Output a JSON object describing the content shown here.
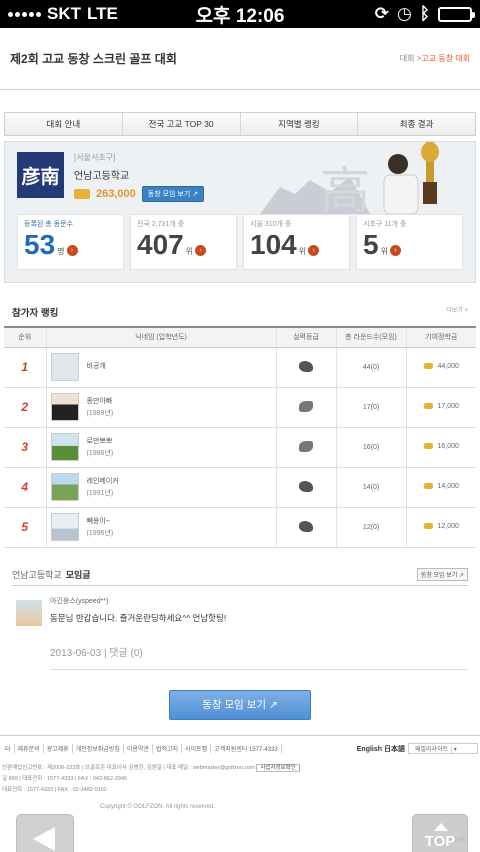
{
  "status_bar": {
    "carrier": "SKT",
    "network": "LTE",
    "time": "오후 12:06"
  },
  "header": {
    "title": "제2회 고교 동창 스크린 골프 대회",
    "crumb_home": "대회 >",
    "crumb_current": "고교 동창 대회"
  },
  "tabs": [
    "대회 안내",
    "전국 고교 TOP 30",
    "지역별 랭킹",
    "최종 결과"
  ],
  "school": {
    "emblem_text": "彦南",
    "region": "[서울서초구]",
    "name": "언남고등학교",
    "points": "263,000",
    "join_label": "동창 모임 보기"
  },
  "stats": [
    {
      "label": "등록된 총 동문수",
      "value": "53",
      "unit": "명"
    },
    {
      "label": "전국 2,731개 중",
      "value": "407",
      "unit": "위"
    },
    {
      "label": "서울 310개 중",
      "value": "104",
      "unit": "위"
    },
    {
      "label": "서초구 11개 중",
      "value": "5",
      "unit": "위"
    }
  ],
  "ranking": {
    "title": "참가자 랭킹",
    "more": "더보기 +",
    "headers": [
      "순위",
      "닉네임 (입학년도)",
      "실력등급",
      "총 라운드수(모임)",
      "기여정학금"
    ],
    "rows": [
      {
        "rank": "1",
        "nick": "비공개",
        "year": "",
        "rounds": "44(0)",
        "amount": "44,000"
      },
      {
        "rank": "2",
        "nick": "종만아빠",
        "year": "(1989년)",
        "rounds": "17(0)",
        "amount": "17,000"
      },
      {
        "rank": "3",
        "nick": "로만뽀뽀",
        "year": "(1986년)",
        "rounds": "16(0)",
        "amount": "16,000"
      },
      {
        "rank": "4",
        "nick": "레인메이커",
        "year": "(1991년)",
        "rounds": "14(0)",
        "amount": "14,000"
      },
      {
        "rank": "5",
        "nick": "뻬용이~",
        "year": "(1996년)",
        "rounds": "12(0)",
        "amount": "12,000"
      }
    ]
  },
  "club": {
    "school": "언남고등학교",
    "title": "모임글",
    "button": "동창 모임 보기",
    "post_author": "아긴옹스(yspeed**)",
    "post_text": "동문님 반갑습니다. 즐거운란딩하세요^^ 언남핫팅!",
    "post_date": "2013-06-03",
    "post_comments": "| 댓글 (0)"
  },
  "big_button": "동창 모임 보기",
  "footer": {
    "links": [
      "터",
      "제휴문의",
      "광고제휴",
      "개인정보취급방침",
      "이용약관",
      "법적고지",
      "사이트맵",
      "고객지원센터 1577-4333"
    ],
    "lang": "English  日本語",
    "family_site": "패밀리사이트",
    "info1": "신판매업신고번호 : 제2006-223호 | 브골프존 대표이사 김병한, 김원일 | 대표 메일 : webmaster@golfzon.com",
    "info_btn": "사업자정보확인",
    "info2": "길 899 | 대표전화 : 1577-4333 | FAX : 042-862-2946",
    "info3": "대표전화 : 1577-4333 | FAX : 02-3482-0162",
    "copyright": "Copyright © GOLFZON. All rights reserved.",
    "facebook": "facebook",
    "top_label": "TOP"
  }
}
